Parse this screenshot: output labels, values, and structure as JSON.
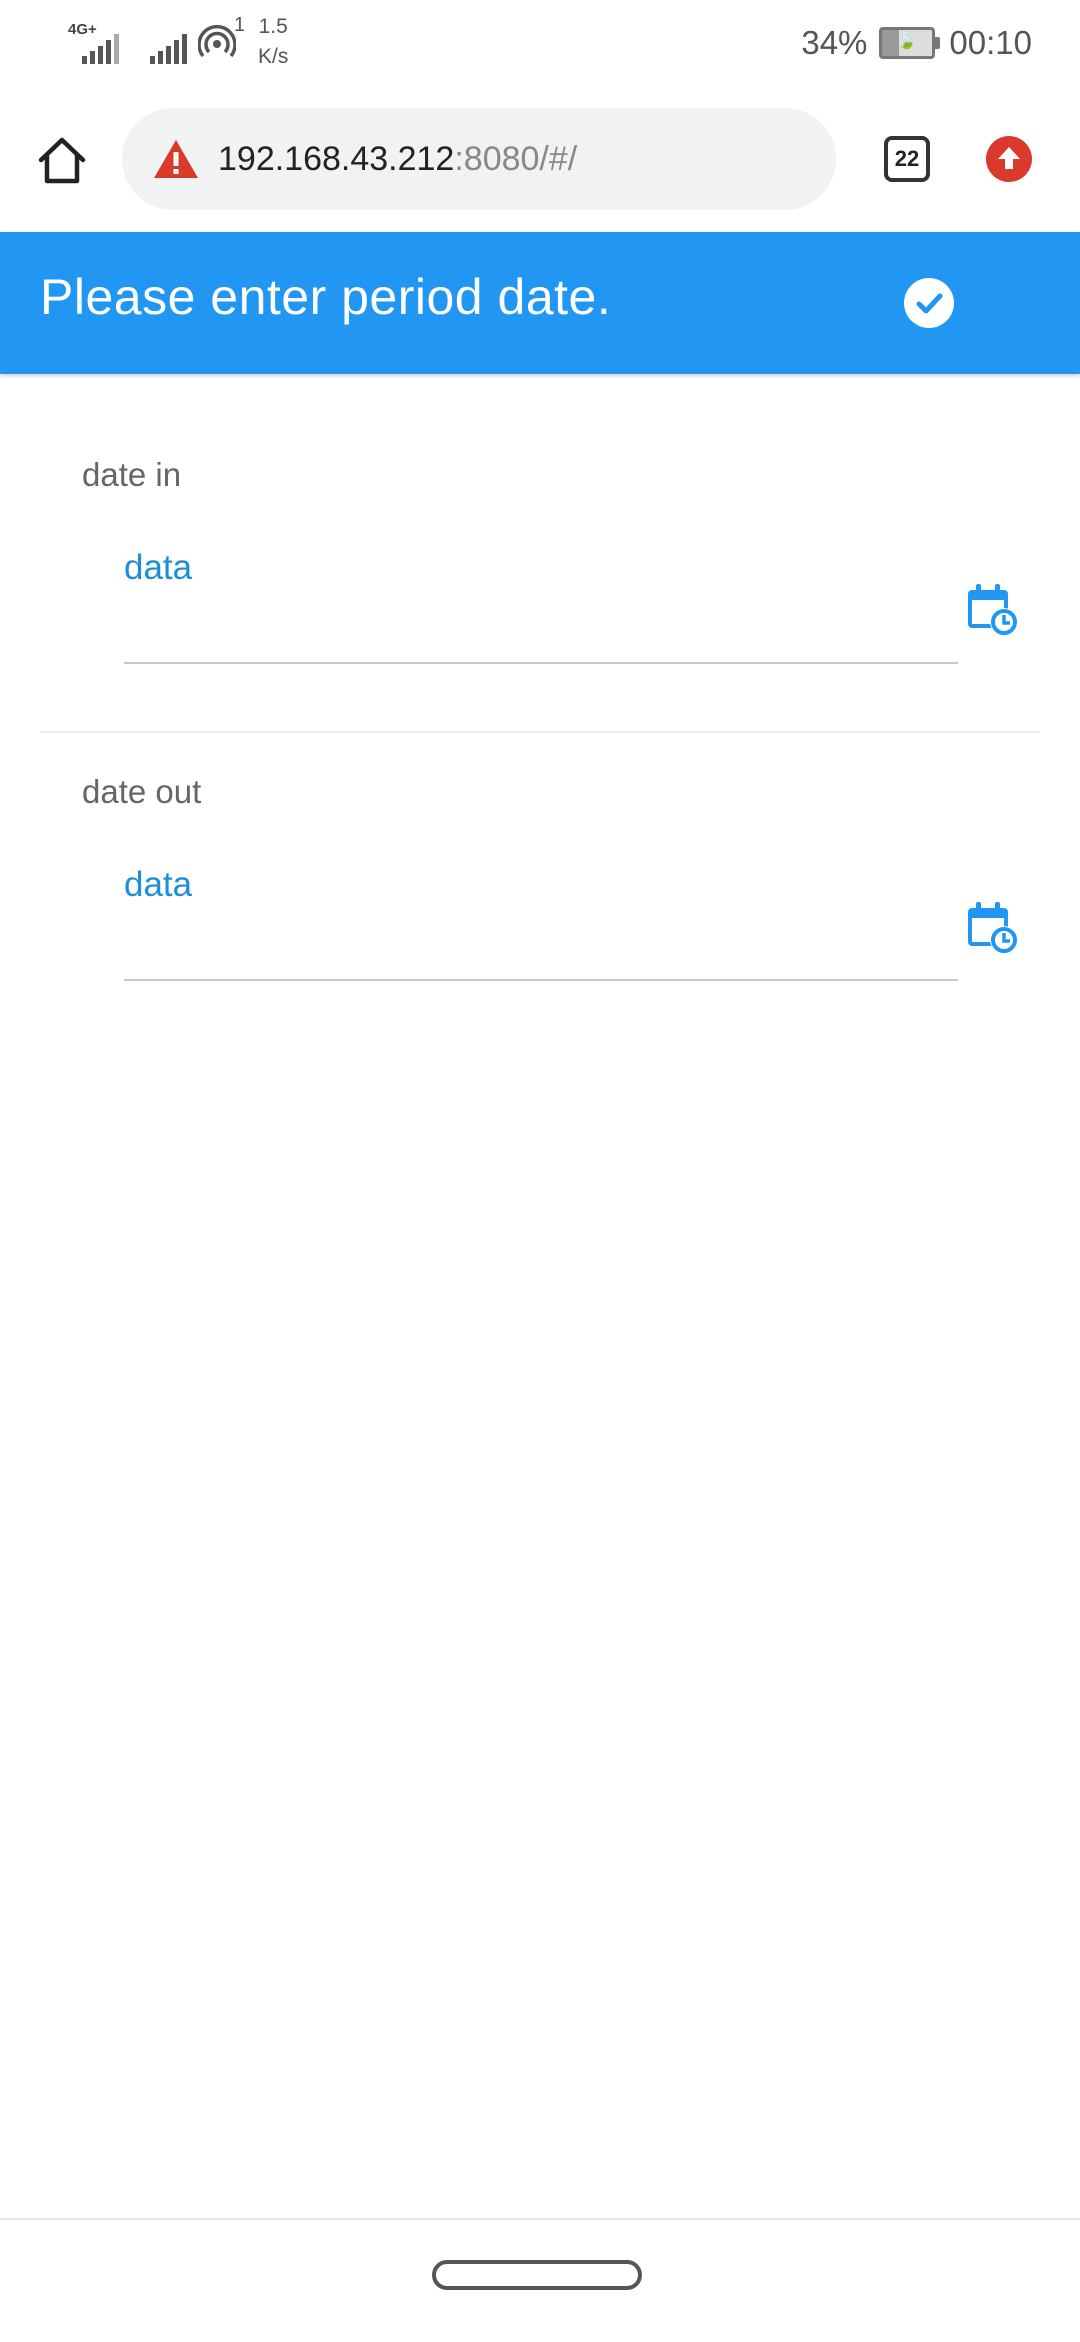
{
  "status_bar": {
    "network_type": "4G+",
    "sim_number": "1",
    "speed_value": "1.5",
    "speed_unit": "K/s",
    "battery_percent": "34%",
    "battery_level": 0.34,
    "time": "00:10"
  },
  "browser": {
    "url_host": "192.168.43.212",
    "url_rest": ":8080/#/",
    "tab_count": "22",
    "warning_icon": "warning-triangle-icon",
    "home_icon": "home-icon",
    "update_icon": "arrow-up-circle-icon"
  },
  "header": {
    "title": "Please enter period date.",
    "confirm_icon": "check-circle-icon",
    "color": "#2196f3"
  },
  "form": {
    "date_in": {
      "label": "date in",
      "value": "data",
      "icon": "calendar-clock-icon"
    },
    "date_out": {
      "label": "date out",
      "value": "data",
      "icon": "calendar-clock-icon"
    }
  },
  "colors": {
    "accent": "#2196f3",
    "input_text": "#1e8fd6",
    "warning": "#d93a2c"
  }
}
